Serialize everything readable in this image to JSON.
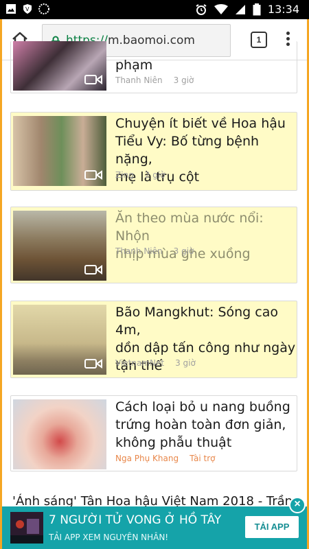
{
  "status_bar": {
    "time": "13:34"
  },
  "browser": {
    "url_scheme": "https://",
    "url_host": "m.baomoi.com",
    "tab_count": "1"
  },
  "articles": [
    {
      "title_lines": [
        "phạm"
      ],
      "source": "Thanh Niên",
      "time": "3 giờ"
    },
    {
      "title_lines": [
        "Chuyện ít biết về Hoa hậu",
        "Tiểu Vy: Bố từng bệnh nặng,",
        "mẹ là trụ cột"
      ],
      "source": "Zing",
      "time": "2 giờ"
    },
    {
      "title_lines": [
        "Ăn theo mùa nước nổi: Nhộn",
        "nhịp mùa ghe xuồng"
      ],
      "source": "Thanh Niên",
      "time": "3 giờ"
    },
    {
      "title_lines": [
        "Bão Mangkhut: Sóng cao 4m,",
        "dồn dập tấn công như ngày",
        "tận thế"
      ],
      "source": "VietnamNet",
      "time": "3 giờ"
    },
    {
      "title_lines": [
        "Cách loại bỏ u nang buồng",
        "trứng hoàn toàn đơn giản,",
        "không phẫu thuật"
      ],
      "source": "Nga Phụ Khang",
      "time": "Tài trợ"
    }
  ],
  "peek_title": "'Ánh sáng' Tân Hoa hậu Việt Nam 2018 - Trần",
  "ad": {
    "title": "7 NGƯỜI TỬ VONG Ở HỒ TÂY",
    "subtitle": "TẢI APP XEM NGUYÊN NHÂN!",
    "button": "TẢI APP",
    "close": "×"
  }
}
